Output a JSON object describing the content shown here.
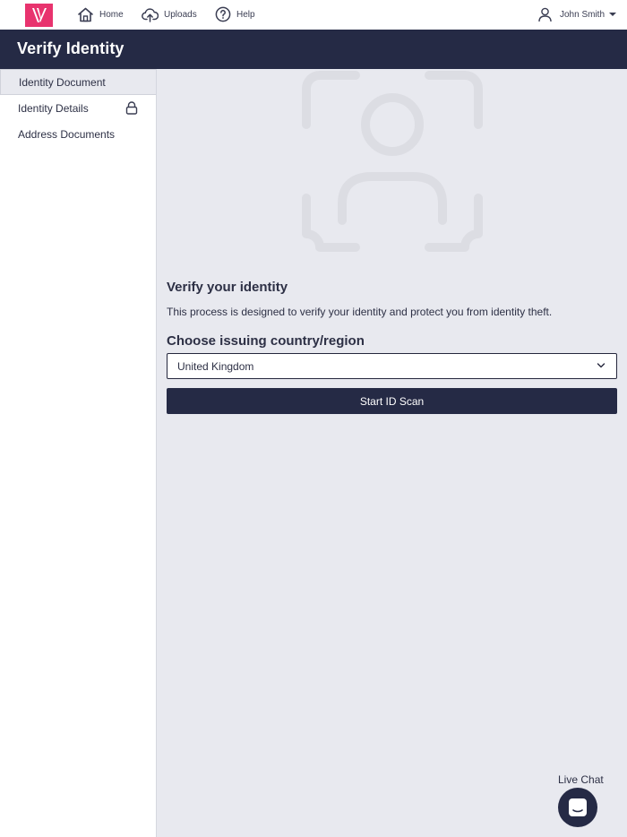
{
  "nav": {
    "home_label": "Home",
    "uploads_label": "Uploads",
    "help_label": "Help",
    "user_name": "John Smith"
  },
  "page": {
    "title": "Verify Identity"
  },
  "sidebar": {
    "items": [
      {
        "label": "Identity Document",
        "active": true
      },
      {
        "label": "Identity Details",
        "locked": true
      },
      {
        "label": "Address Documents"
      }
    ]
  },
  "main": {
    "heading": "Verify your identity",
    "description": "This process is designed to verify your identity and protect you from identity theft.",
    "country_heading": "Choose issuing country/region",
    "country_selected": "United Kingdom",
    "start_button": "Start ID Scan"
  },
  "chat": {
    "label": "Live Chat"
  },
  "colors": {
    "brand": "#e8336e",
    "navy": "#252a45",
    "background": "#e8e9ef"
  },
  "icons": [
    "logo",
    "home-icon",
    "upload-icon",
    "help-icon",
    "user-icon",
    "lock-icon",
    "face-scan-icon",
    "chevron-down-icon",
    "chat-icon"
  ]
}
